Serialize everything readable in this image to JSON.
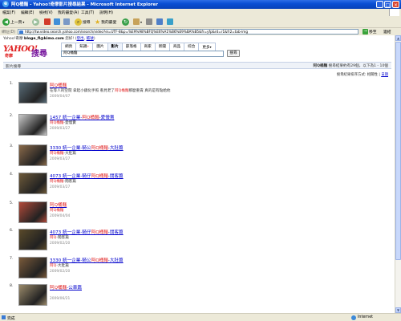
{
  "window": {
    "title": "阿Q桶麵 - Yahoo!奇摩影片搜尋結果 - Microsoft Internet Explorer"
  },
  "menu": [
    "檔案(F)",
    "編輯(E)",
    "檢視(V)",
    "我的最愛(A)",
    "工具(T)",
    "說明(H)"
  ],
  "toolbar": {
    "back": "上一頁",
    "search": "搜尋",
    "favorites": "我的最愛"
  },
  "address": {
    "label": "網址(D)",
    "url": "http://tw.video.search.yahoo.com/search/video?ei=UTF-8&p=%E9%98%BFQ%E6%A1%B6%E9%BA%B5&fr=yfp&rd=r1&fr2=tab-img",
    "go": "移至",
    "links": "連結"
  },
  "ytop": {
    "prefix": "Yahoo!奇摩",
    "user": "bloge_fl@kimo.com",
    "greet": "您好!",
    "logout": "登出",
    "account": "帳號"
  },
  "logo": {
    "brand": "YAHOO!",
    "sub": "奇摩",
    "label": "搜尋"
  },
  "tabs": [
    {
      "label": "網頁",
      "new": ""
    },
    {
      "label": "知識",
      "new": "+"
    },
    {
      "label": "圖片",
      "new": ""
    },
    {
      "label": "影片",
      "new": ""
    },
    {
      "label": "部落格",
      "new": ""
    },
    {
      "label": "商家",
      "new": ""
    },
    {
      "label": "新聞",
      "new": ""
    },
    {
      "label": "商品",
      "new": ""
    },
    {
      "label": "綜合",
      "new": ""
    },
    {
      "label": "更多",
      "new": "▾"
    }
  ],
  "query": "阿Q桶麵",
  "search_button": "搜尋",
  "results_bar": {
    "section": "影片搜尋",
    "summary_prefix": "阿Q桶麵",
    "summary": "搜尋結果約有29個，以下為1 - 10個"
  },
  "sort": {
    "label": "搜尋結果排序方式:",
    "relevance": "相關性",
    "date": "日期"
  },
  "results": [
    {
      "n": "1.",
      "title_a": "",
      "title_hl": "阿Q桶麵",
      "title_b": "",
      "sub_a": "在等人的空閒 拿起小鏡化手照 看見老了",
      "sub_hl": "阿Q桶麵",
      "sub_b": "那麼重責 真的是有點給他",
      "date": "2009/04/07",
      "thumb": "#5a6e7a"
    },
    {
      "n": "2.",
      "title_a": "1457 統一企業-",
      "title_hl": "阿Q桶麵",
      "title_b": "-愛慢賣",
      "sub_a": "",
      "sub_hl": "阿Q桶麵",
      "sub_b": "-愛慢賣",
      "date": "2009/03/27",
      "thumb": "#c9c9c9"
    },
    {
      "n": "3.",
      "title_a": "3330 統一企業-騎公",
      "title_hl": "阿Q桶麵",
      "title_b": "-大肚篇",
      "sub_a": "",
      "sub_hl": "阿Q桶麵",
      "sub_b": "-大肚篇",
      "date": "2009/03/27",
      "thumb": "#8a6a4a"
    },
    {
      "n": "4.",
      "title_a": "4073 統一企業-騎仔",
      "title_hl": "阿Q桶麵",
      "title_b": "-闊客篇",
      "sub_a": "",
      "sub_hl": "阿Q桶麵",
      "sub_b": "-闊客篇",
      "date": "2009/03/27",
      "thumb": "#6e5a3a"
    },
    {
      "n": "5.",
      "title_a": "",
      "title_hl": "阿Q桶麵",
      "title_b": "",
      "sub_a": "",
      "sub_hl": "阿Q桶麵",
      "sub_b": "",
      "date": "2009/04/04",
      "thumb": "#b24a3a"
    },
    {
      "n": "6.",
      "title_a": "4073 統一企業-騎仔",
      "title_hl": "阿Q桶麵",
      "title_b": "-闊客篇",
      "sub_a": "",
      "sub_hl": "阿Q",
      "sub_b": "-闊客篇",
      "date": "2009/02/20",
      "thumb": "#5a4a2a"
    },
    {
      "n": "7.",
      "title_a": "3330 統一企業-騎公",
      "title_hl": "阿Q桶麵",
      "title_b": "-大肚篇",
      "sub_a": "",
      "sub_hl": "阿Q",
      "sub_b": "-大肚篇",
      "date": "2009/02/20",
      "thumb": "#7a5a3a"
    },
    {
      "n": "8.",
      "title_a": "",
      "title_hl": "阿Q桶麵",
      "title_b": "-公車篇",
      "sub_a": "",
      "sub_hl": "",
      "sub_b": "",
      "date": "2009/06/21",
      "thumb": "#9a8a6a"
    }
  ],
  "status": {
    "text": "完成",
    "zone": "Internet"
  }
}
